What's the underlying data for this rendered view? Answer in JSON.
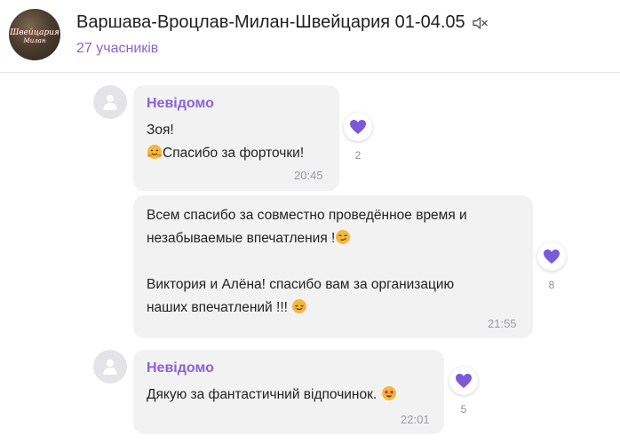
{
  "header": {
    "title": "Варшава-Вроцлав-Милан-Швейцария 01-04.05",
    "members": "27 учасників",
    "avatar_caption_1": "Швейцария",
    "avatar_caption_2": "Милан"
  },
  "messages": [
    {
      "sender": "Невідомо",
      "lines": [
        "Зоя!",
        "Спасибо за форточки!"
      ],
      "time": "20:45",
      "reaction": {
        "icon": "purple-heart-icon",
        "count": "2"
      }
    },
    {
      "lines": [
        "Всем спасибо за совместно проведённое время и",
        "незабываемые впечатления !",
        "",
        "Виктория и Алёна! спасибо вам за организацию",
        "наших впечатлений !!! "
      ],
      "time": "21:55",
      "reaction": {
        "icon": "purple-heart-icon",
        "count": "8"
      }
    },
    {
      "sender": "Невідомо",
      "lines": [
        "Дякую за фантастичний відпочинок. "
      ],
      "time": "22:01",
      "reaction": {
        "icon": "purple-heart-icon",
        "count": "5"
      }
    }
  ],
  "colors": {
    "accent": "#8a63d2",
    "heart": "#7a5ad8",
    "bubble": "#f2f2f3",
    "time": "#9b9ba3"
  }
}
